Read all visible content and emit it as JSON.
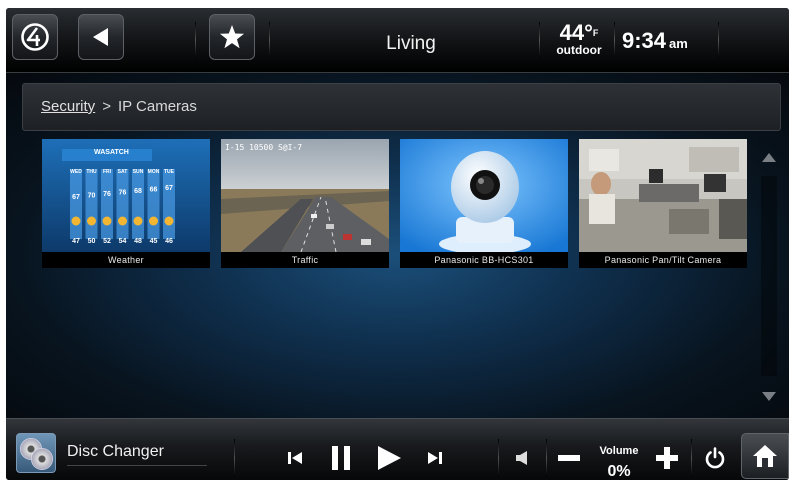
{
  "topbar": {
    "logo_icon": "control4-logo-icon",
    "room": "Living",
    "temperature": "44°",
    "temp_unit": "F",
    "temp_label": "outdoor",
    "time": "9:34",
    "ampm": "am"
  },
  "breadcrumb": {
    "parent": "Security",
    "separator": ">",
    "current": "IP Cameras"
  },
  "cameras": [
    {
      "label": "Weather",
      "forecast_header": "WASATCH",
      "days": [
        "WED",
        "THU",
        "FRI",
        "SAT",
        "SUN",
        "MON",
        "TUE"
      ],
      "highs": [
        "67",
        "70",
        "76",
        "76",
        "68",
        "66",
        "67"
      ],
      "lows": [
        "47",
        "50",
        "52",
        "54",
        "48",
        "45",
        "46"
      ]
    },
    {
      "label": "Traffic",
      "overlay": "I-15 10500 S@I-7"
    },
    {
      "label": "Panasonic BB-HCS301"
    },
    {
      "label": "Panasonic Pan/Tilt Camera"
    }
  ],
  "player": {
    "source": "Disc Changer",
    "volume_label": "Volume",
    "volume_value": "0%"
  },
  "colors": {
    "accent": "#1b4f7a",
    "bar_dark": "#101214"
  }
}
